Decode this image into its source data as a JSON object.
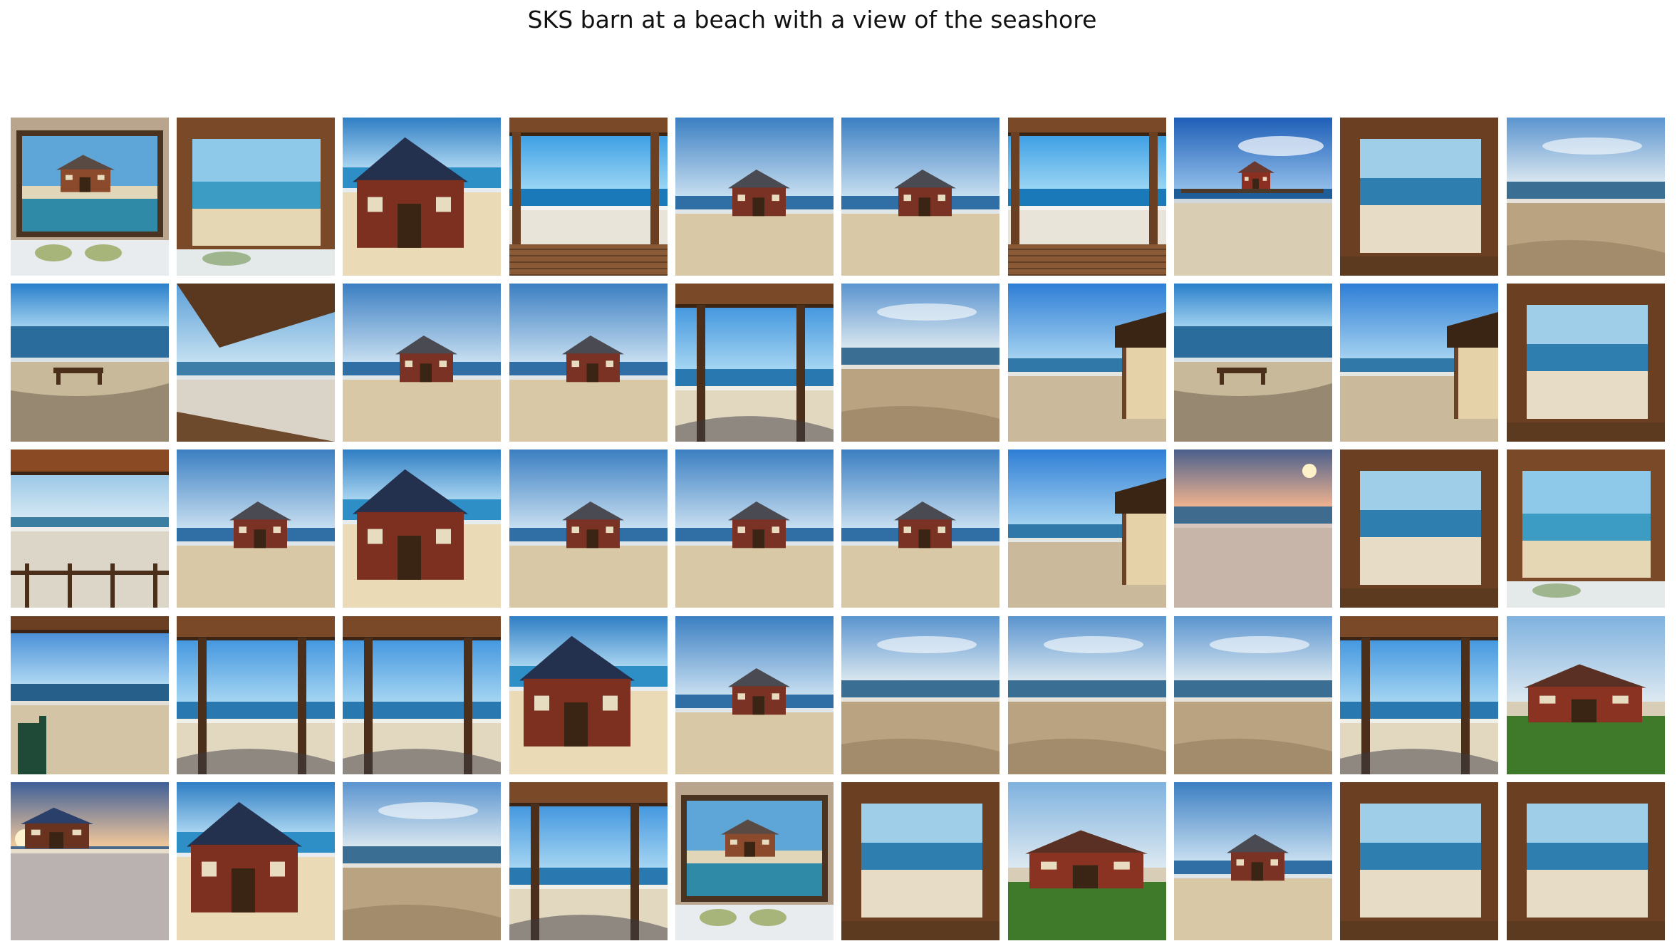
{
  "figure": {
    "title": "SKS barn at a beach with a view of the seashore",
    "rows": 5,
    "columns": 10
  },
  "tiles": [
    {
      "scene": "framed-painting-over-bed"
    },
    {
      "scene": "window-view-with-bed"
    },
    {
      "scene": "barn-on-beach-closeup"
    },
    {
      "scene": "open-doorway-to-beach"
    },
    {
      "scene": "barn-on-beach-far"
    },
    {
      "scene": "barn-on-beach-far"
    },
    {
      "scene": "open-doorway-to-beach"
    },
    {
      "scene": "barn-on-pier"
    },
    {
      "scene": "window-view"
    },
    {
      "scene": "empty-beach"
    },
    {
      "scene": "beach-with-bench"
    },
    {
      "scene": "roof-edge-over-beach"
    },
    {
      "scene": "barn-on-beach-far"
    },
    {
      "scene": "barn-on-beach-far"
    },
    {
      "scene": "pavilion-frame"
    },
    {
      "scene": "empty-beach"
    },
    {
      "scene": "beach-hut-edge"
    },
    {
      "scene": "beach-with-bench"
    },
    {
      "scene": "beach-hut-edge"
    },
    {
      "scene": "window-view"
    },
    {
      "scene": "porch-railing-view"
    },
    {
      "scene": "barn-on-beach-far"
    },
    {
      "scene": "barn-on-beach-closeup"
    },
    {
      "scene": "barn-on-beach-far"
    },
    {
      "scene": "barn-on-beach-far"
    },
    {
      "scene": "barn-on-beach-far"
    },
    {
      "scene": "beach-hut-edge"
    },
    {
      "scene": "sunset-beach"
    },
    {
      "scene": "window-view"
    },
    {
      "scene": "window-view-with-bed"
    },
    {
      "scene": "porch-chair-view"
    },
    {
      "scene": "pavilion-frame"
    },
    {
      "scene": "pavilion-frame"
    },
    {
      "scene": "barn-on-beach-closeup"
    },
    {
      "scene": "barn-on-beach-far"
    },
    {
      "scene": "empty-beach"
    },
    {
      "scene": "empty-beach"
    },
    {
      "scene": "empty-beach"
    },
    {
      "scene": "pavilion-frame"
    },
    {
      "scene": "barn-on-grass"
    },
    {
      "scene": "sunset-beach-hut"
    },
    {
      "scene": "barn-on-beach-closeup"
    },
    {
      "scene": "empty-beach"
    },
    {
      "scene": "pavilion-frame"
    },
    {
      "scene": "framed-painting-over-bed"
    },
    {
      "scene": "window-view"
    },
    {
      "scene": "barn-on-grass"
    },
    {
      "scene": "barn-on-beach-far"
    },
    {
      "scene": "window-view"
    },
    {
      "scene": "window-view"
    }
  ]
}
